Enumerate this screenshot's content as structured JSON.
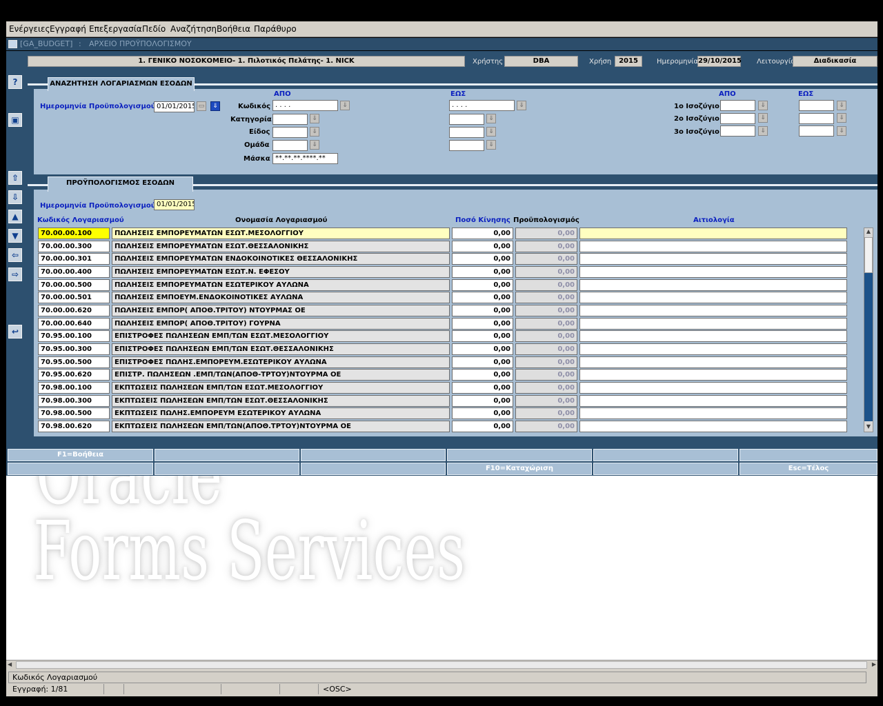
{
  "menu": [
    "Ενέργειες",
    "Εγγραφή",
    "Επεξεργασία",
    "Πεδίο",
    "Αναζήτηση",
    "Βοήθεια",
    "Παράθυρο"
  ],
  "window": {
    "module": "[GA_BUDGET]",
    "separator": ":",
    "title": "ΑΡΧΕΙΟ ΠΡΟΫΠΟΛΟΓΙΣΜΟΥ"
  },
  "header": {
    "company": "1. ΓΕΝΙΚΟ ΝΟΣΟΚΟΜΕΙΟ- 1. Πιλοτικός Πελάτης- 1. NICK",
    "user_label": "Χρήστης",
    "user": "DBA",
    "year_label": "Χρήση",
    "year": "2015",
    "date_label": "Ημερομηνία",
    "date": "29/10/2015",
    "mode_label": "Λειτουργία",
    "mode": "Διαδικασία"
  },
  "search": {
    "tab": "ΑΝΑΖΗΤΗΣΗ ΛΟΓΑΡΙΑΣΜΩΝ ΕΣΟΔΩΝ",
    "date_label": "Ημερομηνία Προϋπολογισμού",
    "date": "01/01/2015",
    "from": "ΑΠΟ",
    "to": "ΕΩΣ",
    "code_label": "Κωδικός",
    "code_from": "  .   .   .     .",
    "code_to": "  .   .   .     .",
    "category_label": "Κατηγορία",
    "kind_label": "Είδος",
    "group_label": "Ομάδα",
    "mask_label": "Μάσκα",
    "mask": "**.**.**.****.**",
    "bal_from": "ΑΠΟ",
    "bal_to": "ΕΩΣ",
    "bal1": "1ο Ισοζύγιο",
    "bal2": "2ο Ισοζύγιο",
    "bal3": "3ο Ισοζύγιο"
  },
  "budget": {
    "tab": "ΠΡΟΫΠΟΛΟΓΙΣΜΟΣ ΕΣΟΔΩΝ",
    "date_label": "Ημερομηνία Προϋπολογισμού",
    "date": "01/01/2015",
    "col_code": "Κωδικός Λογαριασμού",
    "col_name": "Ονομασία Λογαριασμού",
    "col_amount": "Ποσό Κίνησης",
    "col_budget": "Προϋπολογισμός",
    "col_desc": "Αιτιολογία",
    "rows": [
      {
        "code": "70.00.00.100",
        "name": "ΠΩΛΗΣΕΙΣ ΕΜΠΟΡΕΥΜΑΤΩΝ ΕΣΩΤ.ΜΕΣΟΛΟΓΓΙΟΥ",
        "amount": "0,00",
        "budget": "0,00"
      },
      {
        "code": "70.00.00.300",
        "name": "ΠΩΛΗΣΕΙΣ ΕΜΠΟΡΕΥΜΑΤΩΝ ΕΣΩΤ.ΘΕΣΣΑΛΟΝΙΚΗΣ",
        "amount": "0,00",
        "budget": "0,00"
      },
      {
        "code": "70.00.00.301",
        "name": "ΠΩΛΗΣΕΙΣ ΕΜΠΟΡΕΥΜΑΤΩΝ ΕΝΔΟΚΟΙΝΟΤΙΚΕΣ ΘΕΣΣΑΛΟΝΙΚΗΣ",
        "amount": "0,00",
        "budget": "0,00"
      },
      {
        "code": "70.00.00.400",
        "name": "ΠΩΛΗΣΕΙΣ ΕΜΠΟΡΕΥΜΑΤΩΝ ΕΣΩΤ.Ν. ΕΦΕΣΟΥ",
        "amount": "0,00",
        "budget": "0,00"
      },
      {
        "code": "70.00.00.500",
        "name": "ΠΩΛΗΣΕΙΣ ΕΜΠΟΡΕΥΜΑΤΩΝ ΕΣΩΤΕΡΙΚΟΥ ΑΥΛΩΝΑ",
        "amount": "0,00",
        "budget": "0,00"
      },
      {
        "code": "70.00.00.501",
        "name": "ΠΩΛΗΣΕΙΣ ΕΜΠΟΕΥΜ.ΕΝΔΟΚΟΙΝΟΤΙΚΕΣ ΑΥΛΩΝΑ",
        "amount": "0,00",
        "budget": "0,00"
      },
      {
        "code": "70.00.00.620",
        "name": "ΠΩΛΗΣΕΙΣ ΕΜΠΟΡ( ΑΠΟΘ.ΤΡΙΤΟΥ) ΝΤΟΥΡΜΑΣ ΟΕ",
        "amount": "0,00",
        "budget": "0,00"
      },
      {
        "code": "70.00.00.640",
        "name": "ΠΩΛΗΣΕΙΣ ΕΜΠΟΡ( ΑΠΟΘ.ΤΡΙΤΟΥ) ΓΟΥΡΝΑ",
        "amount": "0,00",
        "budget": "0,00"
      },
      {
        "code": "70.95.00.100",
        "name": "ΕΠΙΣΤΡΟΦΕΣ ΠΩΛΗΣΕΩΝ ΕΜΠ/ΤΩΝ ΕΣΩΤ.ΜΕΣΟΛΟΓΓΙΟΥ",
        "amount": "0,00",
        "budget": "0,00"
      },
      {
        "code": "70.95.00.300",
        "name": "ΕΠΙΣΤΡΟΦΕΣ ΠΩΛΗΣΕΩΝ ΕΜΠ/ΤΩΝ ΕΣΩΤ.ΘΕΣΣΑΛΟΝΙΚΗΣ",
        "amount": "0,00",
        "budget": "0,00"
      },
      {
        "code": "70.95.00.500",
        "name": "ΕΠΙΣΤΡΟΦΕΣ ΠΩΛΗΣ.ΕΜΠΟΡΕΥΜ.ΕΣΩΤΕΡΙΚΟΥ ΑΥΛΩΝΑ",
        "amount": "0,00",
        "budget": "0,00"
      },
      {
        "code": "70.95.00.620",
        "name": "ΕΠΙΣΤΡ. ΠΩΛΗΣΕΩΝ .ΕΜΠ/ΤΩΝ(ΑΠΟΘ-ΤΡΤΟΥ)ΝΤΟΥΡΜΑ ΟΕ",
        "amount": "0,00",
        "budget": "0,00"
      },
      {
        "code": "70.98.00.100",
        "name": "ΕΚΠΤΩΣΕΙΣ ΠΩΛΗΣΕΩΝ ΕΜΠ/ΤΩΝ ΕΣΩΤ.ΜΕΣΟΛΟΓΓΙΟΥ",
        "amount": "0,00",
        "budget": "0,00"
      },
      {
        "code": "70.98.00.300",
        "name": "ΕΚΠΤΩΣΕΙΣ ΠΩΛΗΣΕΩΝ ΕΜΠ/ΤΩΝ ΕΣΩΤ.ΘΕΣΣΑΛΟΝΙΚΗΣ",
        "amount": "0,00",
        "budget": "0,00"
      },
      {
        "code": "70.98.00.500",
        "name": "ΕΚΠΤΩΣΕΙΣ ΠΩΛΗΣ.ΕΜΠΟΡΕΥΜ ΕΣΩΤΕΡΙΚΟΥ ΑΥΛΩΝΑ",
        "amount": "0,00",
        "budget": "0,00"
      },
      {
        "code": "70.98.00.620",
        "name": "ΕΚΠΤΩΣΕΙΣ ΠΩΛΗΣΕΩΝ ΕΜΠ/ΤΩΝ(ΑΠΟΘ.ΤΡΤΟΥ)ΝΤΟΥΡΜΑ ΟΕ",
        "amount": "0,00",
        "budget": "0,00"
      }
    ]
  },
  "fkeys": {
    "help": "F1=Βοήθεια",
    "save": "F10=Καταχώριση",
    "exit": "Esc=Τέλος"
  },
  "watermark": {
    "line1": "Oracle",
    "line2": "Forms Services"
  },
  "statusbar": {
    "field": "Κωδικός Λογαριασμού",
    "record": "Εγγραφή: 1/81",
    "osc": "<OSC>"
  },
  "icons": [
    "help-icon",
    "save-icon",
    "first-record-icon",
    "last-record-icon",
    "previous-record-icon",
    "next-record-icon",
    "previous-block-icon",
    "next-block-icon",
    "exit-icon",
    "dropdown-arrow-icon",
    "calendar-icon"
  ]
}
